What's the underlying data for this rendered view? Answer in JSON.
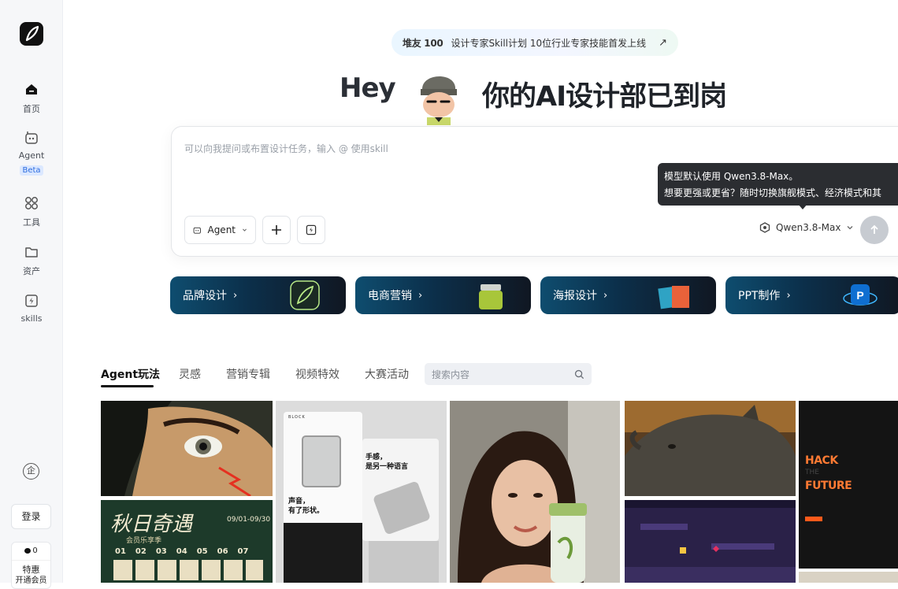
{
  "sidebar": {
    "items": [
      {
        "label": "首页",
        "icon": "home-icon"
      },
      {
        "label": "Agent",
        "icon": "agent-icon",
        "badge": "Beta"
      },
      {
        "label": "工具",
        "icon": "tools-icon"
      },
      {
        "label": "资产",
        "icon": "folder-icon"
      },
      {
        "label": "skills",
        "icon": "skills-icon"
      }
    ],
    "enterprise_icon_text": "企",
    "login_label": "登录",
    "promo": {
      "points": "0",
      "line1": "特惠",
      "line2": "开通会员"
    }
  },
  "announcement": {
    "brand": "堆友 100",
    "text": "设计专家Skill计划 10位行业专家技能首发上线",
    "arrow": "↗"
  },
  "hero": {
    "hey": "Hey",
    "title": "你的AI设计部已到岗"
  },
  "prompt": {
    "placeholder": "可以向我提问或布置设计任务，输入 @ 使用skill",
    "agent_label": "Agent",
    "model_label": "Qwen3.8-Max",
    "tooltip_line1": "模型默认使用 Qwen3.8-Max。",
    "tooltip_line2": "想要更强或更省？随时切换旗舰模式、经济模式和其"
  },
  "categories": [
    {
      "label": "品牌设计"
    },
    {
      "label": "电商营销"
    },
    {
      "label": "海报设计"
    },
    {
      "label": "PPT制作"
    }
  ],
  "tabs": [
    "Agent玩法",
    "灵感",
    "营销专辑",
    "视频特效",
    "大赛活动"
  ],
  "search": {
    "placeholder": "搜索内容"
  },
  "gallery": {
    "autumn": {
      "title": "秋日奇遇",
      "sub": "会员乐享季",
      "dates": "09/01-09/30",
      "numbers": [
        "01",
        "02",
        "03",
        "04",
        "05",
        "06",
        "07"
      ]
    },
    "product": {
      "brand": "BLOCK",
      "line1": "手感，",
      "line2": "是另一种语言",
      "line3": "声音，",
      "line4": "有了形状。"
    },
    "hack": {
      "line1": "HACK",
      "line2": "THE",
      "line3": "FUTURE"
    }
  },
  "colors": {
    "accent": "#2d6cdf",
    "dark": "#111111",
    "card_start": "#0e4d6f"
  }
}
